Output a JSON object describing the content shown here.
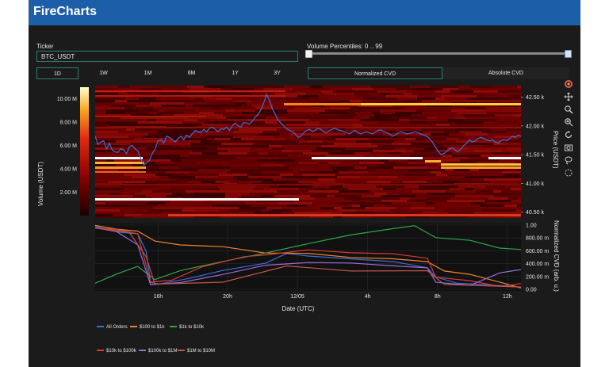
{
  "app": {
    "title": "FireCharts"
  },
  "ticker": {
    "label": "Ticker",
    "value": "BTC_USDT"
  },
  "percentiles": {
    "label": "Volume Percentiles: 0 .. 99",
    "low": 0,
    "high": 99
  },
  "ranges": [
    {
      "label": "1D",
      "active": true
    },
    {
      "label": "1W",
      "active": false
    },
    {
      "label": "1M",
      "active": false
    },
    {
      "label": "6M",
      "active": false
    },
    {
      "label": "1Y",
      "active": false
    },
    {
      "label": "3Y",
      "active": false
    }
  ],
  "cvd_modes": [
    {
      "label": "Normalized CVD",
      "active": true
    },
    {
      "label": "Absolute CVD",
      "active": false
    }
  ],
  "modebar_icons": [
    "plotly-logo-icon",
    "pan-icon",
    "zoom-icon",
    "zoom-in-icon",
    "reset-icon",
    "camera-icon",
    "lasso-icon",
    "autoscale-icon"
  ],
  "colors": {
    "accent": "#2e7d74",
    "header": "#1d5ea8",
    "price": "#3a6fd8"
  },
  "chart_data": [
    {
      "type": "heatmap",
      "title": "",
      "colorbar": {
        "ticks": [
          "10.00 M",
          "8.00 M",
          "6.00 M",
          "4.00 M",
          "2.00 M"
        ],
        "title": "Volume (USDT)",
        "range": [
          0,
          11000000
        ]
      },
      "y_right": {
        "label": "Price (USDT)",
        "ticks": [
          "42.50 k",
          "42.00 k",
          "41.50 k",
          "41.00 k",
          "40.50 k"
        ],
        "range": [
          40400,
          42700
        ]
      },
      "price_series": [
        41820,
        41680,
        41720,
        41740,
        41600,
        41700,
        41580,
        41550,
        41540,
        41600,
        41580,
        41520,
        41640,
        41660,
        41600,
        41560,
        41420,
        41320,
        41360,
        41400,
        41520,
        41600,
        41740,
        41760,
        41700,
        41820,
        41800,
        41760,
        41720,
        41780,
        41820,
        41760,
        41840,
        41800,
        41860,
        41920,
        41900,
        41880,
        41940,
        41900,
        41960,
        41980,
        41940,
        41900,
        41950,
        41940,
        41980,
        41920,
        42000,
        42050,
        42000,
        41980,
        42060,
        42050,
        42030,
        42080,
        42150,
        42200,
        42280,
        42400,
        42550,
        42450,
        42300,
        42200,
        42100,
        42050,
        42000,
        41950,
        41920,
        41900,
        41860,
        41800,
        41820,
        41880,
        41920,
        41940,
        41900,
        41920,
        41960,
        41940,
        41900,
        41880,
        41920,
        41940,
        41960,
        41930,
        41920,
        41900,
        41880,
        41860,
        41900,
        41920,
        41880,
        41860,
        41880,
        41900,
        41880,
        41860,
        41890,
        41920,
        41930,
        41900,
        41880,
        41860,
        41820,
        41840,
        41880,
        41900,
        41880,
        41860,
        41870,
        41880,
        41900,
        41880,
        41860,
        41840,
        41820,
        41780,
        41720,
        41640,
        41560,
        41500,
        41520,
        41560,
        41600,
        41620,
        41580,
        41550,
        41600,
        41660,
        41700,
        41760,
        41720,
        41740,
        41780,
        41800,
        41780,
        41760,
        41740,
        41760,
        41720,
        41700,
        41740,
        41760,
        41740,
        41780,
        41820,
        41800,
        41840,
        41820
      ]
    },
    {
      "type": "line",
      "title": "",
      "xlabel": "Date (UTC)",
      "ylabel": "Normalized CVD (arb. u.)",
      "x_ticks": [
        "16h",
        "20h",
        "12/05",
        "4h",
        "8h",
        "12h"
      ],
      "y_ticks": [
        "1.00",
        "800.00 m",
        "600.00 m",
        "400.00 m",
        "200.00 m",
        "0.00"
      ],
      "ylim": [
        0,
        1
      ],
      "series": [
        {
          "name": "All Orders",
          "color": "#3b6fd6"
        },
        {
          "name": "$100 to $1k",
          "color": "#f0842c"
        },
        {
          "name": "$1k to $10k",
          "color": "#2fa64a"
        },
        {
          "name": "$10k to $100k",
          "color": "#d83a34"
        },
        {
          "name": "$100k to $1M",
          "color": "#9b6ad6"
        },
        {
          "name": "$1M to $10M",
          "color": "#c0554a"
        }
      ]
    }
  ]
}
